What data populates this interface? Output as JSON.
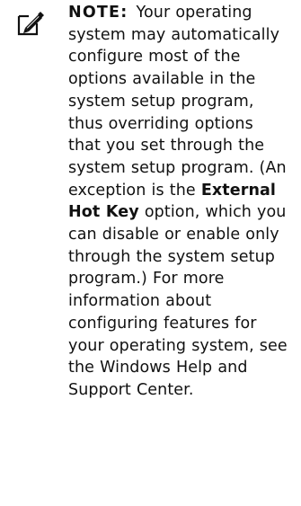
{
  "note": {
    "icon": "pencil-note-icon",
    "label": "NOTE:",
    "text_part1": "Your operating system may automatically configure most of the options available in the system setup program, thus overriding options that you set through the system setup program. (An exception is the",
    "bold_term": "External Hot Key",
    "text_part2": "option, which you can disable or enable only through the system setup program.) For more information about configuring features for your operating system, see the Windows Help and Support Center."
  }
}
